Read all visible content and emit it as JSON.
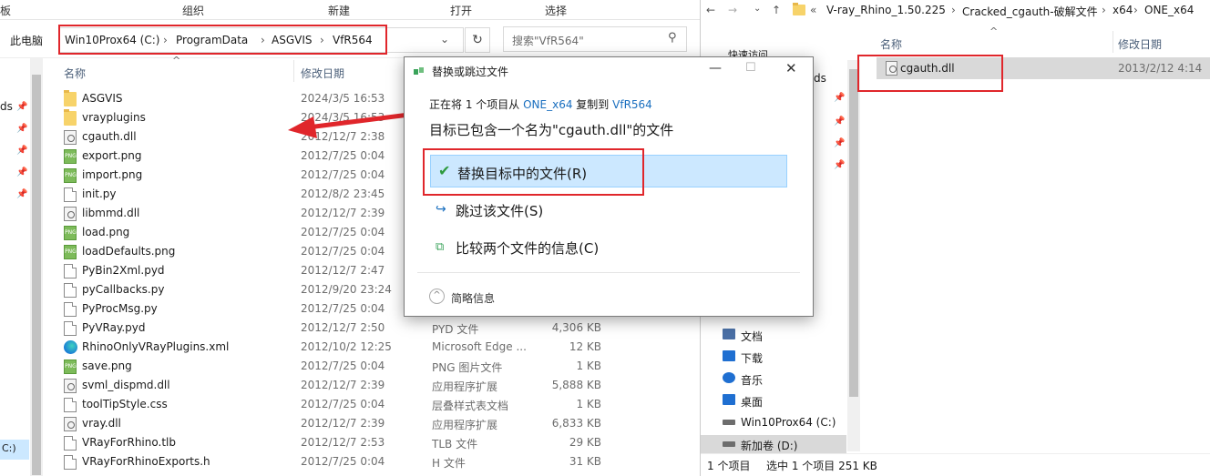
{
  "left_window": {
    "ribbon": [
      "板",
      "组织",
      "新建",
      "打开",
      "选择"
    ],
    "breadcrumb": {
      "root": "此电脑",
      "path": [
        "Win10Prox64 (C:)",
        "ProgramData",
        "ASGVIS",
        "VfR564"
      ]
    },
    "search_placeholder": "搜索\"VfR564\"",
    "columns": {
      "name": "名称",
      "date": "修改日期"
    },
    "nav_fragments": {
      "ds": "ds",
      "drive": "C:)"
    },
    "files": [
      {
        "name": "ASGVIS",
        "date": "2024/3/5 16:53",
        "type": "",
        "size": "",
        "icon": "folder-icon"
      },
      {
        "name": "vrayplugins",
        "date": "2024/3/5 16:53",
        "type": "",
        "size": "",
        "icon": "folder-icon"
      },
      {
        "name": "cgauth.dll",
        "date": "2012/12/7 2:38",
        "type": "",
        "size": "",
        "icon": "dll-icon"
      },
      {
        "name": "export.png",
        "date": "2012/7/25 0:04",
        "type": "",
        "size": "",
        "icon": "png-icon"
      },
      {
        "name": "import.png",
        "date": "2012/7/25 0:04",
        "type": "",
        "size": "",
        "icon": "png-icon"
      },
      {
        "name": "init.py",
        "date": "2012/8/2 23:45",
        "type": "",
        "size": "",
        "icon": "file-icon"
      },
      {
        "name": "libmmd.dll",
        "date": "2012/12/7 2:39",
        "type": "",
        "size": "",
        "icon": "dll-icon"
      },
      {
        "name": "load.png",
        "date": "2012/7/25 0:04",
        "type": "",
        "size": "",
        "icon": "png-icon"
      },
      {
        "name": "loadDefaults.png",
        "date": "2012/7/25 0:04",
        "type": "",
        "size": "",
        "icon": "png-icon"
      },
      {
        "name": "PyBin2Xml.pyd",
        "date": "2012/12/7 2:47",
        "type": "",
        "size": "",
        "icon": "file-icon"
      },
      {
        "name": "pyCallbacks.py",
        "date": "2012/9/20 23:24",
        "type": "",
        "size": "",
        "icon": "file-icon"
      },
      {
        "name": "PyProcMsg.py",
        "date": "2012/7/25 0:04",
        "type": "",
        "size": "",
        "icon": "file-icon"
      },
      {
        "name": "PyVRay.pyd",
        "date": "2012/12/7 2:50",
        "type": "PYD 文件",
        "size": "4,306 KB",
        "icon": "file-icon"
      },
      {
        "name": "RhinoOnlyVRayPlugins.xml",
        "date": "2012/10/2 12:25",
        "type": "Microsoft Edge ...",
        "size": "12 KB",
        "icon": "edge-icon"
      },
      {
        "name": "save.png",
        "date": "2012/7/25 0:04",
        "type": "PNG 图片文件",
        "size": "1 KB",
        "icon": "png-icon"
      },
      {
        "name": "svml_dispmd.dll",
        "date": "2012/12/7 2:39",
        "type": "应用程序扩展",
        "size": "5,888 KB",
        "icon": "dll-icon"
      },
      {
        "name": "toolTipStyle.css",
        "date": "2012/7/25 0:04",
        "type": "层叠样式表文档",
        "size": "1 KB",
        "icon": "file-icon"
      },
      {
        "name": "vray.dll",
        "date": "2012/12/7 2:39",
        "type": "应用程序扩展",
        "size": "6,833 KB",
        "icon": "dll-icon"
      },
      {
        "name": "VRayForRhino.tlb",
        "date": "2012/12/7 2:53",
        "type": "TLB 文件",
        "size": "29 KB",
        "icon": "file-icon"
      },
      {
        "name": "VRayForRhinoExports.h",
        "date": "2012/7/25 0:04",
        "type": "H 文件",
        "size": "31 KB",
        "icon": "file-icon"
      }
    ]
  },
  "right_window": {
    "breadcrumb": [
      "V-ray_Rhino_1.50.225",
      "Cracked_cgauth-破解文件",
      "x64",
      "ONE_x64"
    ],
    "columns": {
      "name": "名称",
      "date": "修改日期"
    },
    "quick_access": "快速访问",
    "nav_fragment": "ds",
    "file": {
      "name": "cgauth.dll",
      "date": "2013/2/12 4:14"
    },
    "nav": [
      {
        "label": "文档",
        "icon": "documents-icon"
      },
      {
        "label": "下载",
        "icon": "download-icon"
      },
      {
        "label": "音乐",
        "icon": "music-icon"
      },
      {
        "label": "桌面",
        "icon": "desktop-icon"
      },
      {
        "label": "Win10Prox64 (C:)",
        "icon": "drive-icon"
      },
      {
        "label": "新加卷 (D:)",
        "icon": "drive-icon"
      }
    ],
    "status": {
      "count": "1 个项目",
      "selected": "选中 1 个项目  251 KB"
    }
  },
  "dialog": {
    "title": "替换或跳过文件",
    "progress": {
      "prefix": "正在将 1 个项目从",
      "source": "ONE_x64",
      "middle": "复制到",
      "dest": "VfR564"
    },
    "message": "目标已包含一个名为\"cgauth.dll\"的文件",
    "option_replace": "替换目标中的文件(R)",
    "option_skip": "跳过该文件(S)",
    "option_compare": "比较两个文件的信息(C)",
    "details": "简略信息"
  },
  "accent": "#e0262b"
}
